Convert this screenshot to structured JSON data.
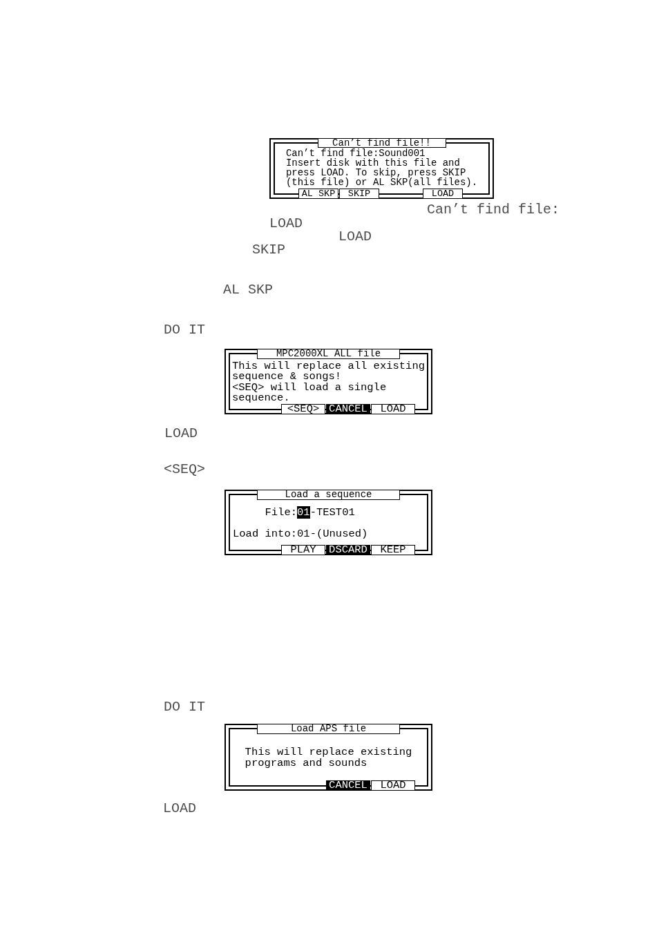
{
  "content": [
    {
      "kind": "screen",
      "title": "Can’t find file!!",
      "lines": [
        "Can’t find file:Sound001",
        "Insert disk with this file and",
        "press LOAD. To skip, press SKIP",
        "(this file) or AL SKP(all files)."
      ],
      "softkey_groups": [
        {
          "keys": [
            {
              "label": "AL SKP",
              "selected": false
            },
            {
              "label": "SKIP",
              "selected": false
            }
          ]
        },
        {
          "keys": [
            {
              "label": "LOAD",
              "selected": false
            }
          ]
        }
      ]
    },
    {
      "kind": "term",
      "text": "Can’t find file:"
    },
    {
      "kind": "term",
      "text": "LOAD"
    },
    {
      "kind": "term",
      "text": "LOAD"
    },
    {
      "kind": "term",
      "text": "SKIP"
    },
    {
      "kind": "term",
      "text": "AL SKP"
    },
    {
      "kind": "term",
      "text": "DO IT"
    },
    {
      "kind": "screen",
      "title": "MPC2000XL ALL file",
      "lines": [
        "This will replace all existing",
        "sequence & songs!",
        "<SEQ> will load a single",
        "sequence."
      ],
      "softkey_groups": [
        {
          "keys": [
            {
              "label": "<SEQ>",
              "selected": false
            },
            {
              "label": "CANCEL",
              "selected": true
            },
            {
              "label": "LOAD",
              "selected": false
            }
          ]
        }
      ]
    },
    {
      "kind": "term",
      "text": "LOAD"
    },
    {
      "kind": "term",
      "text": "<SEQ>"
    },
    {
      "kind": "screen",
      "title": "Load a sequence",
      "fields": [
        {
          "label": "File:",
          "value": "01",
          "selected": true,
          "suffix": "-TEST01"
        },
        {
          "label": "Load into:",
          "value": "01",
          "selected": false,
          "suffix": "-(Unused)"
        }
      ],
      "softkey_groups": [
        {
          "keys": [
            {
              "label": "PLAY",
              "selected": false
            },
            {
              "label": "DSCARD",
              "selected": true
            },
            {
              "label": "KEEP",
              "selected": false
            }
          ]
        }
      ]
    },
    {
      "kind": "term",
      "text": "DO IT"
    },
    {
      "kind": "screen",
      "title": "Load APS file",
      "lines": [
        "This will replace existing",
        "programs and sounds"
      ],
      "softkey_groups": [
        {
          "keys": [
            {
              "label": "CANCEL",
              "selected": true
            },
            {
              "label": "LOAD",
              "selected": false
            }
          ]
        }
      ]
    },
    {
      "kind": "term",
      "text": "LOAD"
    }
  ]
}
